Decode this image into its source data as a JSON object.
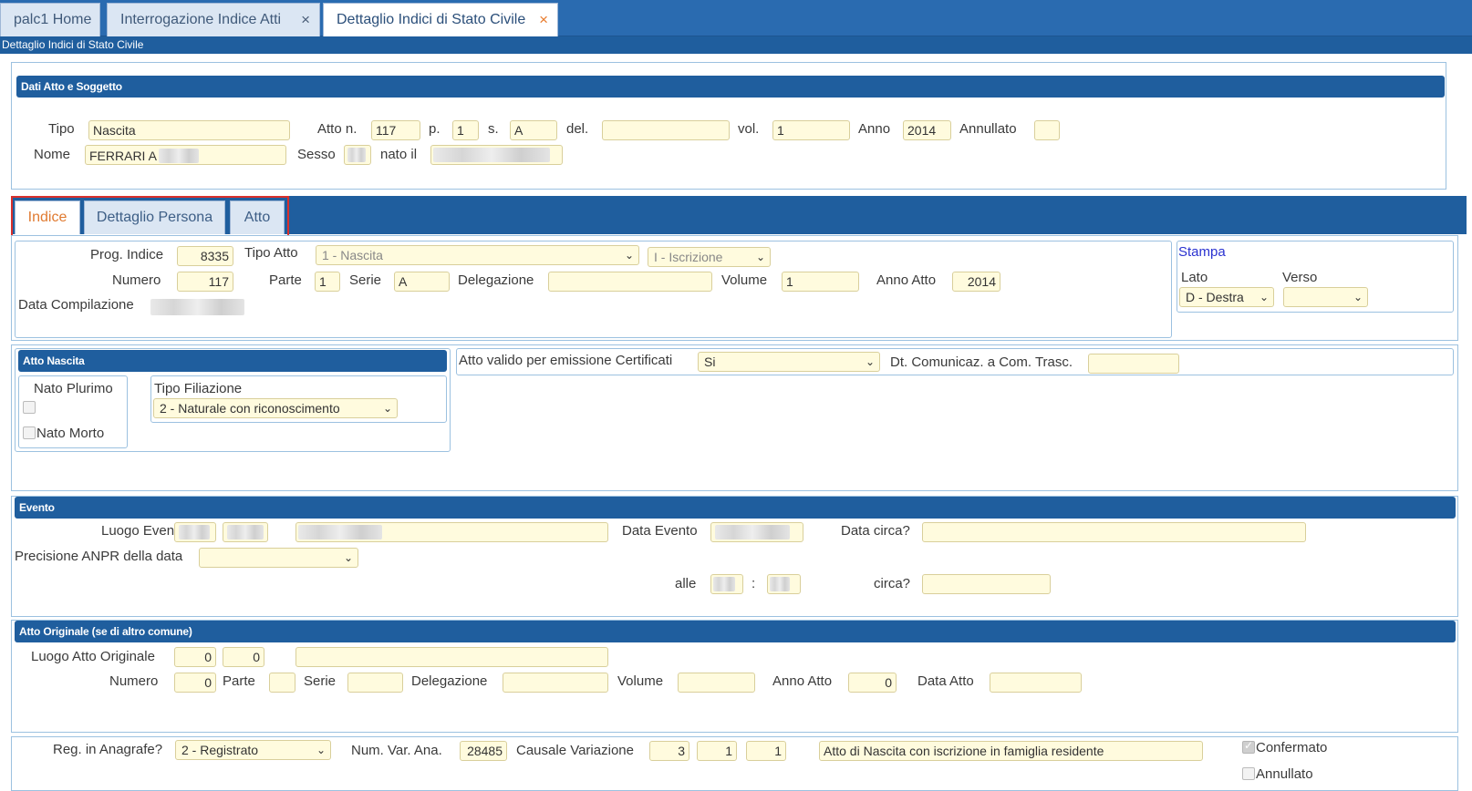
{
  "top_tabs": [
    {
      "label": "palc1 Home"
    },
    {
      "label": "Interrogazione Indice Atti",
      "close": "×"
    },
    {
      "label": "Dettaglio Indici di Stato Civile",
      "close": "×"
    }
  ],
  "subbar_title": "Dettaglio Indici di Stato Civile",
  "dati_atto": {
    "header": "Dati Atto e Soggetto",
    "tipo_label": "Tipo",
    "tipo": "Nascita",
    "atto_n_label": "Atto n.",
    "atto_n": "117",
    "p_label": "p.",
    "p": "1",
    "s_label": "s.",
    "s": "A",
    "del_label": "del.",
    "vol_label": "vol.",
    "vol": "1",
    "anno_label": "Anno",
    "anno": "2014",
    "annullato_label": "Annullato",
    "nome_label": "Nome",
    "nome": "FERRARI A",
    "sesso_label": "Sesso",
    "nato_il_label": "nato il"
  },
  "inner_tabs": [
    {
      "label": "Indice"
    },
    {
      "label": "Dettaglio Persona"
    },
    {
      "label": "Atto"
    }
  ],
  "indice": {
    "prog_label": "Prog. Indice",
    "prog": "8335",
    "tipo_atto_label": "Tipo Atto",
    "tipo_atto": "1 - Nascita",
    "iscrizione": "I - Iscrizione",
    "numero_label": "Numero",
    "numero": "117",
    "parte_label": "Parte",
    "parte": "1",
    "serie_label": "Serie",
    "serie": "A",
    "delegazione_label": "Delegazione",
    "volume_label": "Volume",
    "volume": "1",
    "anno_atto_label": "Anno Atto",
    "anno_atto": "2014",
    "data_comp_label": "Data Compilazione"
  },
  "stampa": {
    "title": "Stampa",
    "lato_label": "Lato",
    "lato": "D - Destra",
    "verso_label": "Verso"
  },
  "atto_nascita": {
    "header": "Atto Nascita",
    "nato_plurimo": "Nato Plurimo",
    "nato_morto": "Nato Morto",
    "tipo_filiazione_label": "Tipo Filiazione",
    "tipo_filiazione": "2 - Naturale con riconoscimento"
  },
  "certificati": {
    "valido_label": "Atto valido per emissione Certificati",
    "valido": "Si",
    "dt_label": "Dt. Comunicaz. a Com. Trasc."
  },
  "evento": {
    "header": "Evento",
    "luogo_label": "Luogo Evento",
    "data_label": "Data Evento",
    "data_circa_label": "Data circa?",
    "precisione_label": "Precisione ANPR della data",
    "alle_label": "alle",
    "colon": ":",
    "circa_label": "circa?"
  },
  "atto_originale": {
    "header": "Atto Originale (se di altro comune)",
    "luogo_label": "Luogo Atto Originale",
    "luogo1": "0",
    "luogo2": "0",
    "numero_label": "Numero",
    "numero": "0",
    "parte_label": "Parte",
    "serie_label": "Serie",
    "delegazione_label": "Delegazione",
    "volume_label": "Volume",
    "anno_label": "Anno Atto",
    "anno": "0",
    "data_label": "Data Atto"
  },
  "anagrafe": {
    "reg_label": "Reg. in Anagrafe?",
    "reg": "2 - Registrato",
    "num_var_label": "Num. Var. Ana.",
    "num_var": "28485",
    "causale_label": "Causale Variazione",
    "c1": "3",
    "c2": "1",
    "c3": "1",
    "causale_desc": "Atto di Nascita con iscrizione in famiglia residente",
    "confermato": "Confermato",
    "annullato": "Annullato"
  }
}
